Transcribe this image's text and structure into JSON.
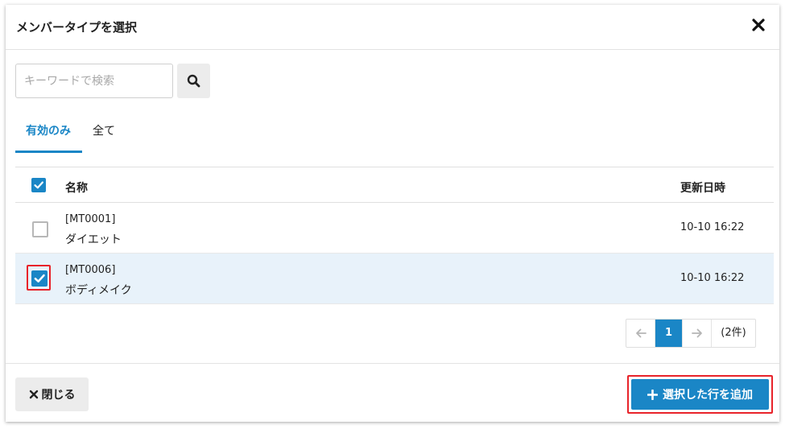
{
  "dialog": {
    "title": "メンバータイプを選択",
    "close_icon": "close-icon"
  },
  "search": {
    "placeholder": "キーワードで検索",
    "value": "",
    "button_icon": "search-icon"
  },
  "tabs": [
    {
      "label": "有効のみ",
      "active": true
    },
    {
      "label": "全て",
      "active": false
    }
  ],
  "table": {
    "select_all_checked": true,
    "columns": {
      "name": "名称",
      "updated": "更新日時"
    },
    "rows": [
      {
        "code": "[MT0001]",
        "name": "ダイエット",
        "updated": "10-10 16:22",
        "checked": false
      },
      {
        "code": "[MT0006]",
        "name": "ボディメイク",
        "updated": "10-10 16:22",
        "checked": true
      }
    ]
  },
  "pagination": {
    "prev_icon": "arrow-left-icon",
    "current_page": "1",
    "next_icon": "arrow-right-icon",
    "count_label": "(2件)"
  },
  "footer": {
    "close_label": "閉じる",
    "add_label": "選択した行を追加"
  },
  "colors": {
    "accent": "#1a86c6",
    "selected_row": "#e8f2fa",
    "highlight": "#e8232a"
  }
}
